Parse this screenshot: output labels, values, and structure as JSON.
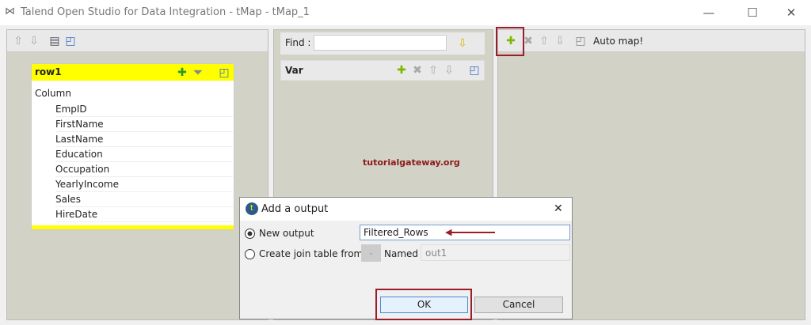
{
  "window": {
    "title": "Talend Open Studio for Data Integration - tMap - tMap_1",
    "minimize": "—",
    "maximize": "☐",
    "close": "✕"
  },
  "input_panel": {
    "table": {
      "name": "row1",
      "column_header": "Column",
      "columns": [
        "EmpID",
        "FirstName",
        "LastName",
        "Education",
        "Occupation",
        "YearlyIncome",
        "Sales",
        "HireDate"
      ]
    }
  },
  "var_panel": {
    "find_label": "Find :",
    "find_value": "",
    "var_title": "Var"
  },
  "output_panel": {
    "auto_map": "Auto map!"
  },
  "watermark": "tutorialgateway.org",
  "dialog": {
    "title": "Add a output",
    "close": "✕",
    "new_output_label": "New output",
    "new_output_value": "Filtered_Rows",
    "join_label": "Create join table from",
    "named_label": "Named",
    "named_value": "out1",
    "ok": "OK",
    "cancel": "Cancel"
  },
  "colors": {
    "highlight": "#9b1c2a",
    "yellow": "#ffff00"
  }
}
